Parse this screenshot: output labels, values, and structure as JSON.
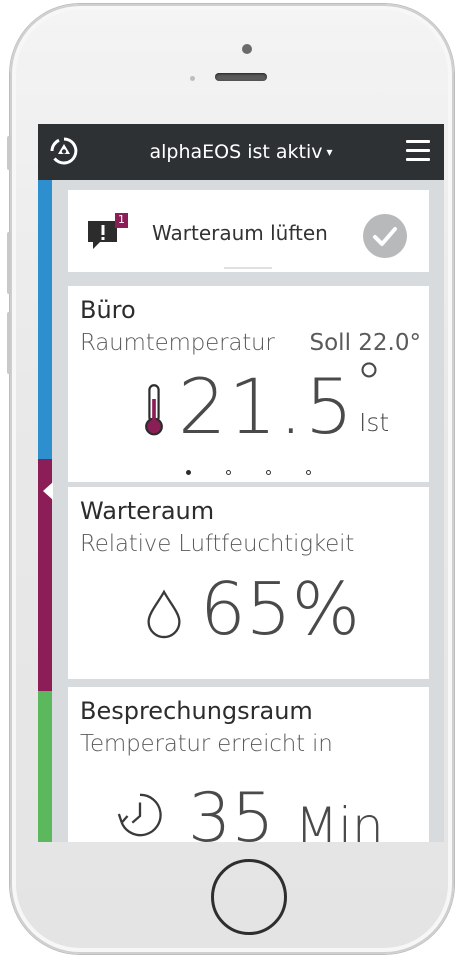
{
  "header": {
    "title": "alphaEOS ist aktiv",
    "caret": "▾",
    "logo_icon": "alphaeos-logo-icon",
    "menu_icon": "hamburger-menu-icon"
  },
  "notification": {
    "badge": "1",
    "text": "Warteraum lüften",
    "icon": "alert-speech-bubble-icon",
    "action_icon": "checkmark-icon"
  },
  "cards": [
    {
      "room": "Büro",
      "label": "Raumtemperatur",
      "setpoint": "Soll 22.0°",
      "value": "21.5",
      "unit_degree": "°",
      "unit_sub": "Ist",
      "icon": "thermometer-icon",
      "color": "#2e8fcf"
    },
    {
      "room": "Warteraum",
      "label": "Relative Luftfeuchtigkeit",
      "value": "65%",
      "icon": "water-drop-icon",
      "color": "#8b1e57"
    },
    {
      "room": "Besprechungsraum",
      "label": "Temperatur erreicht in",
      "value": "35",
      "unit": "Min",
      "icon": "timer-icon",
      "color": "#5cb85c"
    }
  ],
  "pager": {
    "pages": 4,
    "active": 1
  },
  "colors": {
    "topbar": "#2e3134",
    "background": "#d7dbde",
    "badge": "#8b1e57"
  }
}
